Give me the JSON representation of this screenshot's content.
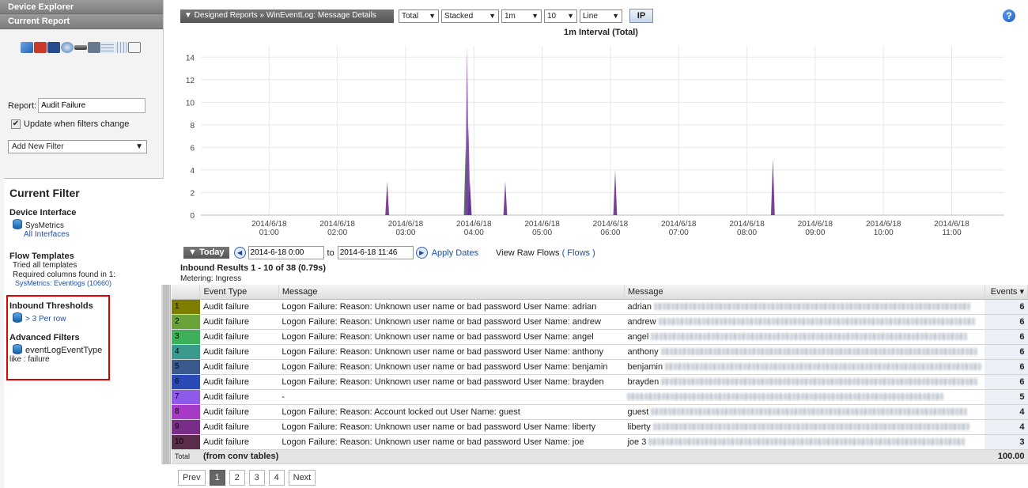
{
  "sidebar": {
    "device_explorer": "Device Explorer",
    "current_report": "Current Report",
    "report_label": "Report:",
    "report_value": "Audit Failure",
    "update_label": "Update when filters change",
    "update_checked": true,
    "add_filter": "Add New Filter",
    "current_filter_title": "Current Filter",
    "device_interface_title": "Device Interface",
    "device_name": "SysMetrics",
    "device_interfaces": "All Interfaces",
    "flow_templates_title": "Flow Templates",
    "flow_tried": "Tried all templates",
    "flow_required": "Required columns found in 1:",
    "flow_source": "SysMetrics: Eventlogs (10660)",
    "inbound_title": "Inbound Thresholds",
    "inbound_value": "> 3 Per row",
    "advanced_title": "Advanced Filters",
    "advanced_field": "eventLogEventType",
    "advanced_value": "like : failure"
  },
  "toolbar": {
    "report_path": "▼ Designed Reports » WinEventLog: Message Details",
    "total": "Total",
    "stacked": "Stacked",
    "interval": "1m",
    "count": "10",
    "chart_type": "Line",
    "ip": "IP",
    "help": "?"
  },
  "chart_data": {
    "type": "area",
    "title": "1m Interval (Total)",
    "ylim": [
      0,
      15
    ],
    "yticks": [
      0,
      2,
      4,
      6,
      8,
      10,
      12,
      14
    ],
    "x_labels": [
      [
        "2014/6/18",
        "01:00"
      ],
      [
        "2014/6/18",
        "02:00"
      ],
      [
        "2014/6/18",
        "03:00"
      ],
      [
        "2014/6/18",
        "04:00"
      ],
      [
        "2014/6/18",
        "05:00"
      ],
      [
        "2014/6/18",
        "06:00"
      ],
      [
        "2014/6/18",
        "07:00"
      ],
      [
        "2014/6/18",
        "08:00"
      ],
      [
        "2014/6/18",
        "09:00"
      ],
      [
        "2014/6/18",
        "10:00"
      ],
      [
        "2014/6/18",
        "11:00"
      ]
    ],
    "x_label_hours": [
      1,
      2,
      3,
      4,
      5,
      6,
      7,
      8,
      9,
      10,
      11
    ],
    "x_range_hours": [
      0.0,
      11.77
    ],
    "spikes": [
      {
        "hour": 2.73,
        "value": 3,
        "color": "#6b2e8a"
      },
      {
        "hour": 3.88,
        "value": 6,
        "color": "#2e7d32"
      },
      {
        "hour": 3.9,
        "value": 15,
        "color": "#7a3fa0"
      },
      {
        "hour": 3.92,
        "value": 8,
        "color": "#7a3fa0"
      },
      {
        "hour": 3.94,
        "value": 3,
        "color": "#5a3090"
      },
      {
        "hour": 4.46,
        "value": 3,
        "color": "#6b2e8a"
      },
      {
        "hour": 6.07,
        "value": 4,
        "color": "#6b2e8a"
      },
      {
        "hour": 8.38,
        "value": 5,
        "color": "#6b2e8a"
      }
    ]
  },
  "dates": {
    "today": "▼ Today",
    "from": "2014-6-18 0:00",
    "to_label": "to",
    "to": "2014-6-18 11:46",
    "apply": "Apply Dates",
    "view_raw": "View Raw Flows",
    "flows_link": "( Flows )"
  },
  "results": {
    "title": "Inbound Results 1 - 10 of 38 (0.79s)",
    "metering": "Metering: Ingress",
    "columns": [
      "Event Type",
      "Message",
      "Message",
      "Events ▾"
    ],
    "rows": [
      {
        "n": "1",
        "color": "#7d7d00",
        "type": "Audit failure",
        "msg": "Logon Failure: Reason: Unknown user name or bad password User Name: adrian",
        "msg2": "adrian",
        "events": "6"
      },
      {
        "n": "2",
        "color": "#6aa33a",
        "type": "Audit failure",
        "msg": "Logon Failure: Reason: Unknown user name or bad password User Name: andrew",
        "msg2": "andrew",
        "events": "6"
      },
      {
        "n": "3",
        "color": "#3eb05a",
        "type": "Audit failure",
        "msg": "Logon Failure: Reason: Unknown user name or bad password User Name: angel",
        "msg2": "angel",
        "events": "6"
      },
      {
        "n": "4",
        "color": "#3a9a8e",
        "type": "Audit failure",
        "msg": "Logon Failure: Reason: Unknown user name or bad password User Name: anthony",
        "msg2": "anthony",
        "events": "6"
      },
      {
        "n": "5",
        "color": "#3a5a8e",
        "type": "Audit failure",
        "msg": "Logon Failure: Reason: Unknown user name or bad password User Name: benjamin",
        "msg2": "benjamin",
        "events": "6"
      },
      {
        "n": "6",
        "color": "#2a4ab8",
        "type": "Audit failure",
        "msg": "Logon Failure: Reason: Unknown user name or bad password User Name: brayden",
        "msg2": "brayden",
        "events": "6"
      },
      {
        "n": "7",
        "color": "#8e5ae8",
        "type": "Audit failure",
        "msg": "-",
        "msg2": "",
        "events": "5"
      },
      {
        "n": "8",
        "color": "#a83ac8",
        "type": "Audit failure",
        "msg": "Logon Failure: Reason: Account locked out User Name: guest",
        "msg2": "guest",
        "events": "4"
      },
      {
        "n": "9",
        "color": "#7a2e8a",
        "type": "Audit failure",
        "msg": "Logon Failure: Reason: Unknown user name or bad password User Name: liberty",
        "msg2": "liberty",
        "events": "4"
      },
      {
        "n": "10",
        "color": "#5a2e4a",
        "type": "Audit failure",
        "msg": "Logon Failure: Reason: Unknown user name or bad password User Name: joe",
        "msg2": "joe 3",
        "events": "3"
      }
    ],
    "total_label": "Total",
    "total_note": "(from conv tables)",
    "total_value": "100.00"
  },
  "pager": {
    "prev": "Prev",
    "pages": [
      "1",
      "2",
      "3",
      "4"
    ],
    "current": "1",
    "next": "Next"
  }
}
